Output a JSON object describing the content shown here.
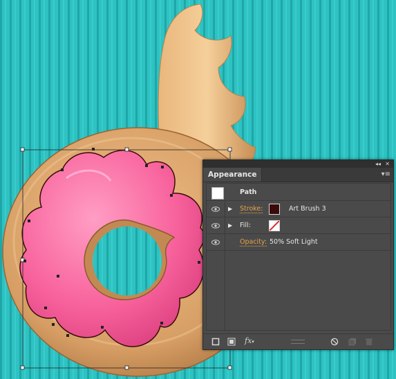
{
  "panel": {
    "tab_label": "Appearance",
    "collapse_glyph": "◂◂",
    "close_glyph": "✕",
    "menu_glyph": "▾≡",
    "rows": [
      {
        "kind": "path",
        "label": "Path"
      },
      {
        "kind": "stroke",
        "attr_label": "Stroke:",
        "value": "Art Brush 3",
        "swatch_color": "#3a0a0a"
      },
      {
        "kind": "fill",
        "attr_label": "Fill:",
        "swatch": "none"
      },
      {
        "kind": "opacity",
        "attr_label": "Opacity:",
        "value": "50% Soft Light"
      }
    ],
    "bottom_icons": [
      "new-stroke-icon",
      "new-fill-icon",
      "fx-icon",
      "clear-appearance-icon",
      "duplicate-item-icon",
      "delete-item-icon"
    ],
    "fx_label": "fx"
  },
  "colors": {
    "background_teal": "#2fc3c3",
    "donut_tan": "#d9a36a",
    "icing_pink": "#f7609b",
    "panel_bg": "#4a4a4a",
    "link_orange": "#e8a34a"
  }
}
